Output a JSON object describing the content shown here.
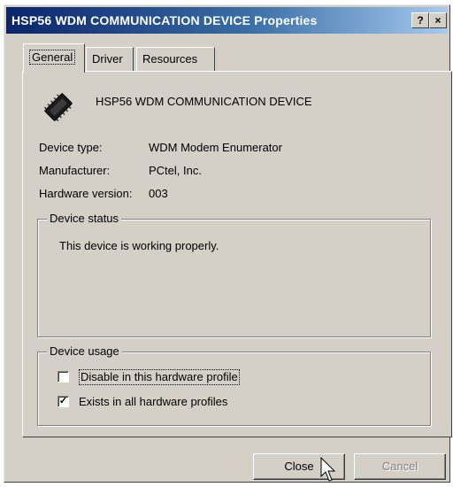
{
  "window": {
    "title": "HSP56 WDM COMMUNICATION DEVICE Properties",
    "help_button": "?",
    "close_button": "×"
  },
  "tabs": [
    {
      "label": "General"
    },
    {
      "label": "Driver"
    },
    {
      "label": "Resources"
    }
  ],
  "device": {
    "name": "HSP56 WDM COMMUNICATION DEVICE",
    "icon": "modem-chip-icon"
  },
  "properties": [
    {
      "label": "Device type:",
      "value": "WDM Modem Enumerator"
    },
    {
      "label": "Manufacturer:",
      "value": "PCtel, Inc."
    },
    {
      "label": "Hardware version:",
      "value": "003"
    }
  ],
  "device_status": {
    "title": "Device status",
    "text": "This device is working properly."
  },
  "device_usage": {
    "title": "Device usage",
    "options": [
      {
        "label": "Disable in this hardware profile",
        "checked": false
      },
      {
        "label": "Exists in all hardware profiles",
        "checked": true
      }
    ]
  },
  "buttons": {
    "close": "Close",
    "cancel": "Cancel"
  },
  "colors": {
    "titlebar_start": "#0a246a",
    "titlebar_end": "#a6caf0",
    "face": "#d4d0c8"
  }
}
